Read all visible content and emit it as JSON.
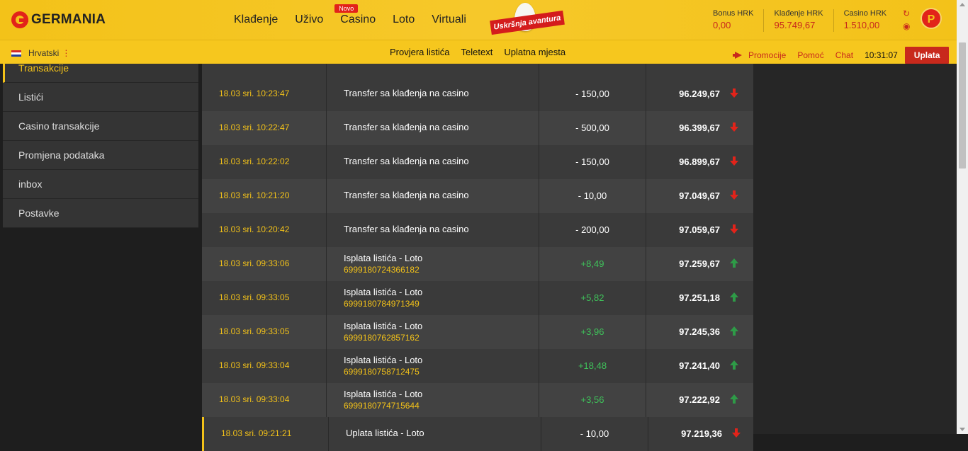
{
  "header": {
    "logo_text": "GERMANIA",
    "nav": [
      {
        "label": "Klađenje"
      },
      {
        "label": "Uživo"
      },
      {
        "label": "Casino",
        "badge": "Novo"
      },
      {
        "label": "Loto"
      },
      {
        "label": "Virtuali"
      }
    ],
    "promo_label": "Uskršnja avantura",
    "balances": [
      {
        "label": "Bonus HRK",
        "value": "0,00"
      },
      {
        "label": "Klađenje HRK",
        "value": "95.749,67"
      },
      {
        "label": "Casino HRK",
        "value": "1.510,00"
      }
    ],
    "avatar_letter": "P"
  },
  "subbar": {
    "language": "Hrvatski",
    "links": [
      "Provjera listića",
      "Teletext",
      "Uplatna mjesta"
    ],
    "promotions": "Promocije",
    "help": "Pomoć",
    "chat": "Chat",
    "time": "10:31:07",
    "deposit": "Uplata"
  },
  "sidebar": {
    "items": [
      "Transakcije",
      "Listići",
      "Casino transakcije",
      "Promjena podataka",
      "inbox",
      "Postavke"
    ]
  },
  "transactions": [
    {
      "date": "18.03 sri. 10:23:47",
      "desc": "Transfer sa klađenja na casino",
      "ticket": "",
      "amount": "- 150,00",
      "balance": "96.249,67",
      "dir": "down"
    },
    {
      "date": "18.03 sri. 10:22:47",
      "desc": "Transfer sa klađenja na casino",
      "ticket": "",
      "amount": "- 500,00",
      "balance": "96.399,67",
      "dir": "down"
    },
    {
      "date": "18.03 sri. 10:22:02",
      "desc": "Transfer sa klađenja na casino",
      "ticket": "",
      "amount": "- 150,00",
      "balance": "96.899,67",
      "dir": "down"
    },
    {
      "date": "18.03 sri. 10:21:20",
      "desc": "Transfer sa klađenja na casino",
      "ticket": "",
      "amount": "- 10,00",
      "balance": "97.049,67",
      "dir": "down"
    },
    {
      "date": "18.03 sri. 10:20:42",
      "desc": "Transfer sa klađenja na casino",
      "ticket": "",
      "amount": "- 200,00",
      "balance": "97.059,67",
      "dir": "down"
    },
    {
      "date": "18.03 sri. 09:33:06",
      "desc": "Isplata listića - Loto",
      "ticket": "6999180724366182",
      "amount": "+8,49",
      "balance": "97.259,67",
      "dir": "up"
    },
    {
      "date": "18.03 sri. 09:33:05",
      "desc": "Isplata listića - Loto",
      "ticket": "6999180784971349",
      "amount": "+5,82",
      "balance": "97.251,18",
      "dir": "up"
    },
    {
      "date": "18.03 sri. 09:33:05",
      "desc": "Isplata listića - Loto",
      "ticket": "6999180762857162",
      "amount": "+3,96",
      "balance": "97.245,36",
      "dir": "up"
    },
    {
      "date": "18.03 sri. 09:33:04",
      "desc": "Isplata listića - Loto",
      "ticket": "6999180758712475",
      "amount": "+18,48",
      "balance": "97.241,40",
      "dir": "up"
    },
    {
      "date": "18.03 sri. 09:33:04",
      "desc": "Isplata listića - Loto",
      "ticket": "6999180774715644",
      "amount": "+3,56",
      "balance": "97.222,92",
      "dir": "up"
    },
    {
      "date": "18.03 sri. 09:21:21",
      "desc": "Uplata listića - Loto",
      "ticket": "",
      "amount": "- 10,00",
      "balance": "97.219,36",
      "dir": "down"
    }
  ],
  "colors": {
    "brand_yellow": "#f3c219",
    "brand_red": "#e2231a",
    "positive": "#3fc05a"
  }
}
